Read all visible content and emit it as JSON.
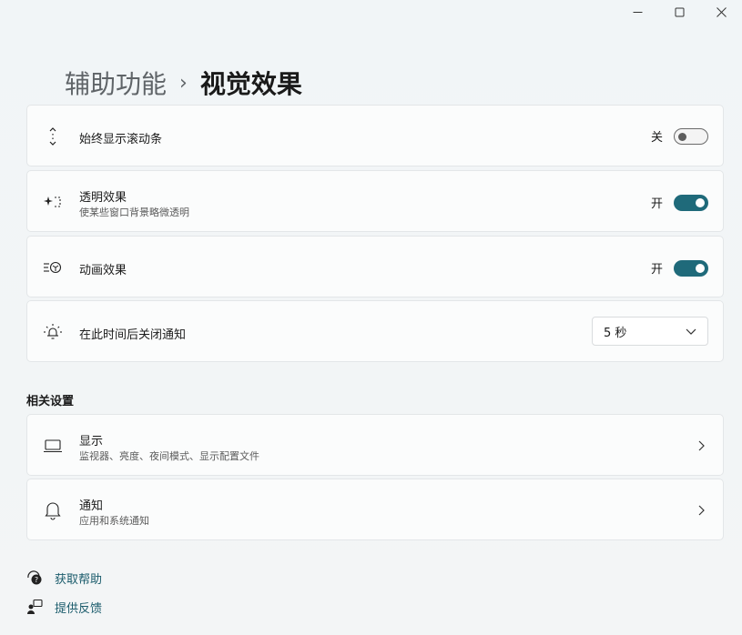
{
  "window": {
    "controls": {
      "minimize": "minimize-icon",
      "maximize": "maximize-icon",
      "close": "close-icon"
    }
  },
  "breadcrumb": {
    "parent": "辅助功能",
    "separator": "›",
    "current": "视觉效果"
  },
  "settings": [
    {
      "label": "始终显示滚动条",
      "state_text": "关",
      "state": "off",
      "icon": "scrollbar-icon"
    },
    {
      "label": "透明效果",
      "description": "使某些窗口背景略微透明",
      "state_text": "开",
      "state": "on",
      "icon": "transparency-icon"
    },
    {
      "label": "动画效果",
      "state_text": "开",
      "state": "on",
      "icon": "animation-icon"
    },
    {
      "label": "在此时间后关闭通知",
      "select_value": "5 秒",
      "icon": "notification-timer-icon"
    }
  ],
  "related": {
    "title": "相关设置",
    "items": [
      {
        "label": "显示",
        "description": "监视器、亮度、夜间模式、显示配置文件",
        "icon": "display-icon"
      },
      {
        "label": "通知",
        "description": "应用和系统通知",
        "icon": "bell-icon"
      }
    ]
  },
  "links": [
    {
      "label": "获取帮助",
      "icon": "help-icon"
    },
    {
      "label": "提供反馈",
      "icon": "feedback-icon"
    }
  ],
  "colors": {
    "accent": "#1f6a7a",
    "link": "#1a5b6b",
    "background": "#eef3f5",
    "card": "#fbfcfc"
  }
}
